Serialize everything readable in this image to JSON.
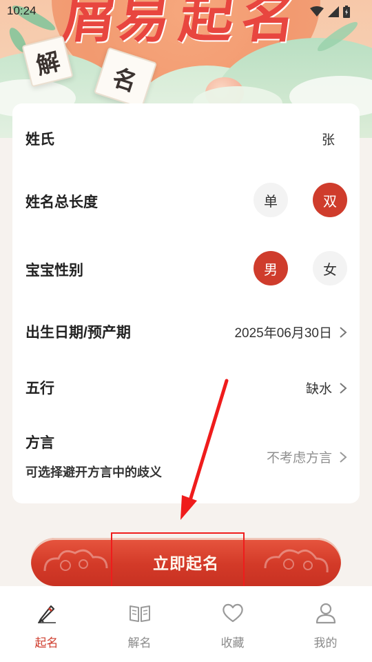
{
  "status_bar": {
    "time": "10:24",
    "icons": [
      "wifi-icon",
      "signal-icon",
      "battery-icon"
    ]
  },
  "banner": {
    "title_chars": [
      "屑",
      "易",
      "起",
      "名"
    ],
    "paper_chars": [
      "解",
      "名"
    ]
  },
  "form": {
    "surname": {
      "label": "姓氏",
      "value": "张"
    },
    "name_length": {
      "label": "姓名总长度",
      "options": [
        "单",
        "双"
      ],
      "selected": "双"
    },
    "gender": {
      "label": "宝宝性别",
      "options": [
        "男",
        "女"
      ],
      "selected": "男"
    },
    "birth_date": {
      "label": "出生日期/预产期",
      "value": "2025年06月30日"
    },
    "five_elements": {
      "label": "五行",
      "value": "缺水"
    },
    "dialect": {
      "label": "方言",
      "sublabel": "可选择避开方言中的歧义",
      "value": "不考虑方言"
    }
  },
  "cta": {
    "label": "立即起名"
  },
  "bottom_nav": {
    "items": [
      {
        "label": "起名",
        "icon": "pencil-icon",
        "active": true
      },
      {
        "label": "解名",
        "icon": "book-icon",
        "active": false
      },
      {
        "label": "收藏",
        "icon": "heart-icon",
        "active": false
      },
      {
        "label": "我的",
        "icon": "user-icon",
        "active": false
      }
    ]
  },
  "colors": {
    "accent": "#cf3c2c",
    "background": "#f6f2ee",
    "annotation": "#ef1c1c"
  }
}
